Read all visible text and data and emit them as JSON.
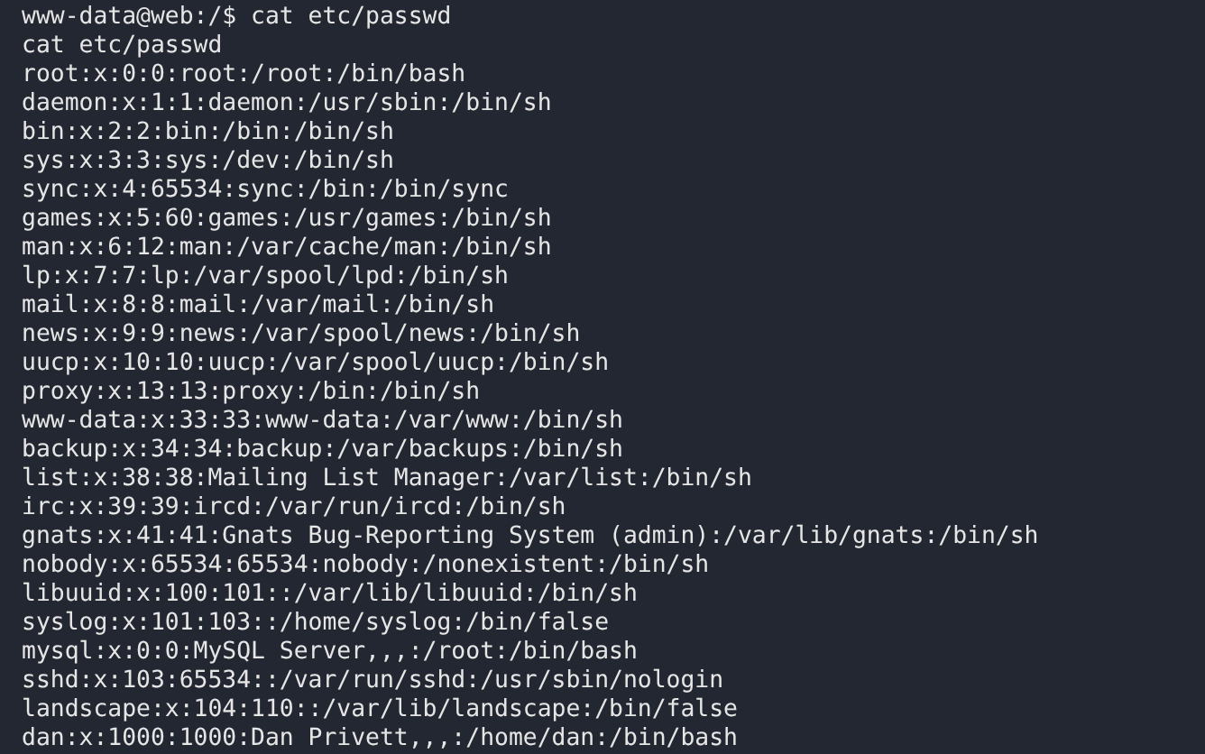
{
  "terminal": {
    "lines": [
      "www-data@web:/$ cat etc/passwd",
      "cat etc/passwd",
      "root:x:0:0:root:/root:/bin/bash",
      "daemon:x:1:1:daemon:/usr/sbin:/bin/sh",
      "bin:x:2:2:bin:/bin:/bin/sh",
      "sys:x:3:3:sys:/dev:/bin/sh",
      "sync:x:4:65534:sync:/bin:/bin/sync",
      "games:x:5:60:games:/usr/games:/bin/sh",
      "man:x:6:12:man:/var/cache/man:/bin/sh",
      "lp:x:7:7:lp:/var/spool/lpd:/bin/sh",
      "mail:x:8:8:mail:/var/mail:/bin/sh",
      "news:x:9:9:news:/var/spool/news:/bin/sh",
      "uucp:x:10:10:uucp:/var/spool/uucp:/bin/sh",
      "proxy:x:13:13:proxy:/bin:/bin/sh",
      "www-data:x:33:33:www-data:/var/www:/bin/sh",
      "backup:x:34:34:backup:/var/backups:/bin/sh",
      "list:x:38:38:Mailing List Manager:/var/list:/bin/sh",
      "irc:x:39:39:ircd:/var/run/ircd:/bin/sh",
      "gnats:x:41:41:Gnats Bug-Reporting System (admin):/var/lib/gnats:/bin/sh",
      "nobody:x:65534:65534:nobody:/nonexistent:/bin/sh",
      "libuuid:x:100:101::/var/lib/libuuid:/bin/sh",
      "syslog:x:101:103::/home/syslog:/bin/false",
      "mysql:x:0:0:MySQL Server,,,:/root:/bin/bash",
      "sshd:x:103:65534::/var/run/sshd:/usr/sbin/nologin",
      "landscape:x:104:110::/var/lib/landscape:/bin/false",
      "dan:x:1000:1000:Dan Privett,,,:/home/dan:/bin/bash"
    ]
  }
}
